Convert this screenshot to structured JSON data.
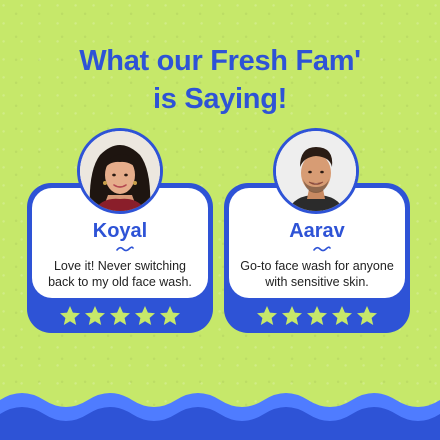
{
  "headline": {
    "line1": "What our Fresh Fam'",
    "line2": "is Saying!"
  },
  "colors": {
    "background": "#c6e86a",
    "brand_blue": "#2e53d6",
    "star_fill": "#c6e86a"
  },
  "testimonials": [
    {
      "name": "Koyal",
      "quote": "Love it! Never switching back to my old face wash.",
      "rating": 5,
      "avatar": "woman-portrait"
    },
    {
      "name": "Aarav",
      "quote": "Go-to face wash for anyone with sensitive skin.",
      "rating": 5,
      "avatar": "man-portrait"
    }
  ]
}
